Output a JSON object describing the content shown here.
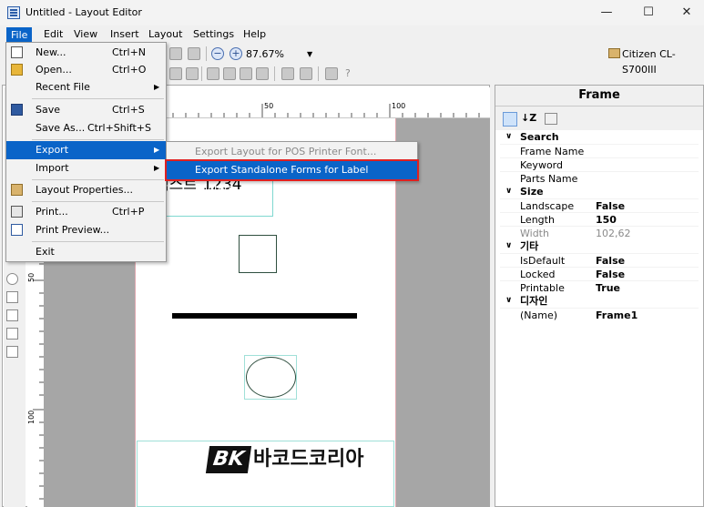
{
  "window": {
    "title": "Untitled - Layout Editor",
    "minimize": "—",
    "maximize": "☐",
    "close": "✕"
  },
  "menubar": {
    "file": "File",
    "edit": "Edit",
    "view": "View",
    "insert": "Insert",
    "layout": "Layout",
    "settings": "Settings",
    "help": "Help"
  },
  "toolbar": {
    "zoom": "87.67%",
    "printer": "Citizen CL-S700III"
  },
  "ruler": {
    "top_50": "50",
    "top_100": "100",
    "left_50": "50",
    "left_100": "100"
  },
  "canvas": {
    "text_object": "텍스트 1234",
    "logo_mark": "BK",
    "logo_text": "바코드코리아"
  },
  "file_menu": {
    "items": [
      {
        "label": "New...",
        "shortcut": "Ctrl+N"
      },
      {
        "label": "Open...",
        "shortcut": "Ctrl+O"
      },
      {
        "label": "Recent File",
        "shortcut": ""
      },
      {
        "label": "Save",
        "shortcut": "Ctrl+S"
      },
      {
        "label": "Save As...",
        "shortcut": "Ctrl+Shift+S"
      },
      {
        "label": "Export",
        "shortcut": ""
      },
      {
        "label": "Import",
        "shortcut": ""
      },
      {
        "label": "Layout Properties...",
        "shortcut": ""
      },
      {
        "label": "Print...",
        "shortcut": "Ctrl+P"
      },
      {
        "label": "Print Preview...",
        "shortcut": ""
      },
      {
        "label": "Exit",
        "shortcut": ""
      }
    ]
  },
  "export_menu": {
    "items": [
      {
        "label": "Export Layout for POS Printer Font...",
        "enabled": false
      },
      {
        "label": "Export Standalone Forms for Label Printers...",
        "enabled": true
      }
    ]
  },
  "properties": {
    "title": "Frame",
    "categories": [
      {
        "name": "Search",
        "rows": [
          {
            "name": "Frame Name",
            "value": ""
          },
          {
            "name": "Keyword",
            "value": ""
          },
          {
            "name": "Parts Name",
            "value": ""
          }
        ]
      },
      {
        "name": "Size",
        "rows": [
          {
            "name": "Landscape",
            "value": "False"
          },
          {
            "name": "Length",
            "value": "150"
          },
          {
            "name": "Width",
            "value": "102,62"
          }
        ]
      },
      {
        "name": "기타",
        "rows": [
          {
            "name": "IsDefault",
            "value": "False"
          },
          {
            "name": "Locked",
            "value": "False"
          },
          {
            "name": "Printable",
            "value": "True"
          }
        ]
      },
      {
        "name": "디자인",
        "rows": [
          {
            "name": "(Name)",
            "value": "Frame1"
          }
        ]
      }
    ]
  },
  "colors": {
    "accent": "#0a64c8",
    "highlight_border": "#e02020"
  }
}
